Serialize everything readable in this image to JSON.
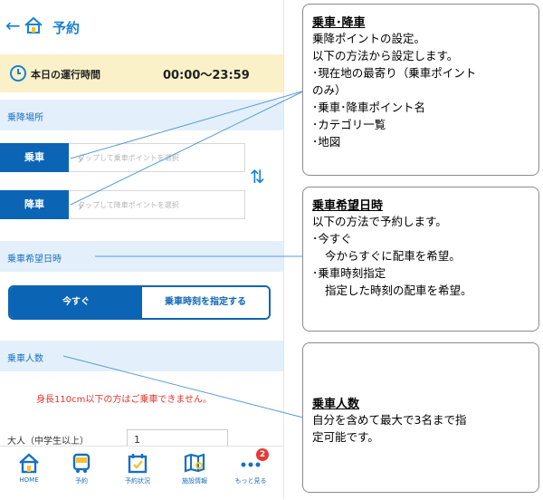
{
  "header": {
    "back_icon": "←",
    "title": "予約"
  },
  "hours": {
    "label": "本日の運行時間",
    "value": "00:00〜23:59"
  },
  "section_boarding": {
    "label": "乗降場所"
  },
  "pickup": {
    "tag": "乗車",
    "placeholder": "タップして乗車ポイントを選択"
  },
  "dropoff": {
    "tag": "降車",
    "placeholder": "タップして降車ポイントを選択"
  },
  "swap_icon": "⇅",
  "section_datetime": {
    "label": "乗車希望日時"
  },
  "datetime": {
    "now": "今すぐ",
    "specify": "乗車時刻を指定する"
  },
  "section_passengers": {
    "label": "乗車人数"
  },
  "warning": "身長110cm以下の方はご乗車できません。",
  "passenger_row": {
    "label": "大人（中学生以上）",
    "count": "1"
  },
  "tabs": [
    {
      "label": "HOME",
      "icon": "home-icon"
    },
    {
      "label": "予約",
      "icon": "bus-icon"
    },
    {
      "label": "予約状況",
      "icon": "calendar-icon"
    },
    {
      "label": "施設情報",
      "icon": "map-icon"
    },
    {
      "label": "もっと見る",
      "icon": "more-icon",
      "badge": "2"
    }
  ],
  "callouts": {
    "boarding": {
      "title": "乗車･降車",
      "lines": [
        "乗降ポイントの設定。",
        "以下の方法から設定します。",
        "･現在地の最寄り（乗車ポイント",
        "のみ）",
        "･乗車･降車ポイント名",
        "･カテゴリ一覧",
        "･地図"
      ]
    },
    "datetime": {
      "title": "乗車希望日時",
      "lines": [
        "以下の方法で予約します。",
        "･今すぐ",
        "今からすぐに配車を希望。",
        "･乗車時刻指定",
        "指定した時刻の配車を希望。"
      ]
    },
    "passengers": {
      "title": "乗車人数",
      "lines": [
        "自分を含めて最大で3名まで指",
        "定可能です。"
      ]
    }
  },
  "colors": {
    "accent": "#1a80d9",
    "primary": "#0c64b5",
    "section_bg": "#e3f0fb",
    "hours_bg": "#fbf1c9",
    "warning": "#e8322a",
    "badge": "#e53935"
  }
}
